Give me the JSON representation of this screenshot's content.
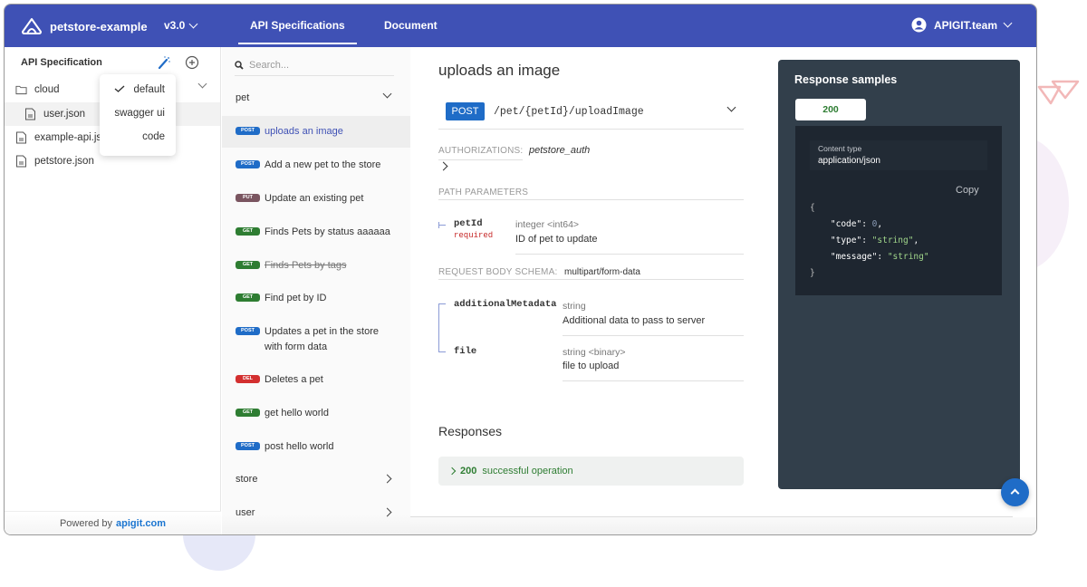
{
  "header": {
    "project_name": "petstore-example",
    "version": "v3.0",
    "tabs": [
      {
        "label": "API Specifications",
        "active": true
      },
      {
        "label": "Document",
        "active": false
      }
    ],
    "user": "APIGIT.team",
    "brand_color": "#3f51b5"
  },
  "sidebar": {
    "title": "API Specification",
    "tree": [
      {
        "type": "folder",
        "label": "cloud",
        "expanded": true
      },
      {
        "type": "file",
        "label": "user.json",
        "selected": true
      },
      {
        "type": "file",
        "label": "example-api.json"
      },
      {
        "type": "file",
        "label": "petstore.json"
      }
    ],
    "view_menu": {
      "items": [
        {
          "label": "default",
          "checked": true
        },
        {
          "label": "swagger ui",
          "checked": false
        },
        {
          "label": "code",
          "checked": false
        }
      ]
    },
    "footer": {
      "prefix": "Powered by",
      "link": "apigit.com"
    }
  },
  "nav": {
    "search_placeholder": "Search...",
    "groups": [
      {
        "label": "pet",
        "expanded": true
      },
      {
        "label": "store",
        "expanded": false
      },
      {
        "label": "user",
        "expanded": false
      }
    ],
    "operations": [
      {
        "method": "POST",
        "label": "uploads an image",
        "active": true,
        "deprecated": false
      },
      {
        "method": "POST",
        "label": "Add a new pet to the store",
        "active": false,
        "deprecated": false
      },
      {
        "method": "PUT",
        "label": "Update an existing pet",
        "active": false,
        "deprecated": false
      },
      {
        "method": "GET",
        "label": "Finds Pets by status aaaaaa",
        "active": false,
        "deprecated": false
      },
      {
        "method": "GET",
        "label": "Finds Pets by tags",
        "active": false,
        "deprecated": true
      },
      {
        "method": "GET",
        "label": "Find pet by ID",
        "active": false,
        "deprecated": false
      },
      {
        "method": "POST",
        "label": "Updates a pet in the store with form data",
        "active": false,
        "deprecated": false
      },
      {
        "method": "DEL",
        "label": "Deletes a pet",
        "active": false,
        "deprecated": false
      },
      {
        "method": "GET",
        "label": "get hello world",
        "active": false,
        "deprecated": false
      },
      {
        "method": "POST",
        "label": "post hello world",
        "active": false,
        "deprecated": false
      }
    ],
    "method_colors": {
      "POST": "#1f6cc7",
      "PUT": "#7a5560",
      "GET": "#2e7d32",
      "DEL": "#d32f2f"
    }
  },
  "operation": {
    "title": "uploads an image",
    "method": "POST",
    "path": "/pet/{petId}/uploadImage",
    "authorizations_label": "AUTHORIZATIONS:",
    "authorization": "petstore_auth",
    "path_params_label": "PATH PARAMETERS",
    "path_params": [
      {
        "name": "petId",
        "required": "required",
        "type": "integer <int64>",
        "description": "ID of pet to update"
      }
    ],
    "request_body_label": "REQUEST BODY SCHEMA:",
    "request_body_type": "multipart/form-data",
    "body_params": [
      {
        "name": "additionalMetadata",
        "type": "string",
        "description": "Additional data to pass to server"
      },
      {
        "name": "file",
        "type": "string <binary>",
        "description": "file to upload"
      }
    ],
    "responses_title": "Responses",
    "responses": [
      {
        "code": "200",
        "description": "successful operation"
      }
    ]
  },
  "samples": {
    "title": "Response samples",
    "tabs": [
      "200"
    ],
    "content_type_label": "Content type",
    "content_type": "application/json",
    "copy_label": "Copy",
    "json": {
      "open": "{",
      "lines": [
        {
          "key": "\"code\"",
          "value": "0",
          "kind": "num",
          "trail": ","
        },
        {
          "key": "\"type\"",
          "value": "\"string\"",
          "kind": "str",
          "trail": ","
        },
        {
          "key": "\"message\"",
          "value": "\"string\"",
          "kind": "str",
          "trail": ""
        }
      ],
      "close": "}"
    }
  }
}
